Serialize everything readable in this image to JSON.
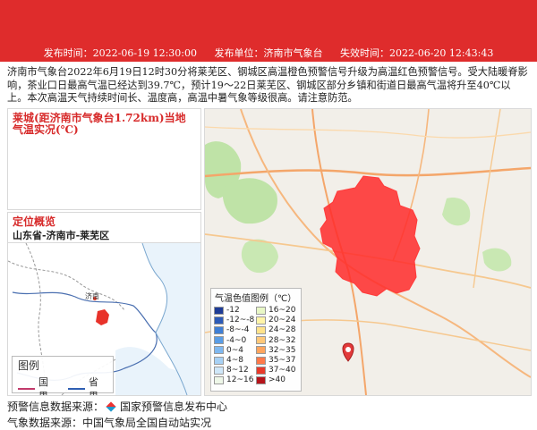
{
  "header": {
    "publish_time": "发布时间：2022-06-19 12:30:00",
    "publisher": "发布单位：济南市气象台",
    "expire_time": "失效时间：2022-06-20 12:43:43",
    "color": "#df2c2c"
  },
  "description": "济南市气象台2022年6月19日12时30分将莱芜区、钢城区高温橙色预警信号升级为高温红色预警信号。受大陆暖脊影响，茶业口日最高气温已经达到39.7℃，预计19～22日莱芜区、钢城区部分乡镇和街道日最高气温将升至40℃以上。本次高温天气持续时间长、温度高，高温中暑气象等级很高。请注意防范。",
  "temp_panel": {
    "title": "莱城(距济南市气象台1.72km)当地气温实况(℃)"
  },
  "location": {
    "title": "定位概览",
    "path": "山东省-济南市-莱芜区"
  },
  "minimap": {
    "city_label": "济南",
    "legend_title": "图例",
    "national_border": "国界",
    "provincial_border": "省界"
  },
  "mainmap": {
    "legend_title": "气温色值图例（℃）",
    "legend_items": [
      {
        "label": "-12",
        "color": "#1e3c96"
      },
      {
        "label": "16~20",
        "color": "#e8f7c6"
      },
      {
        "label": "-12~-8",
        "color": "#2d5bb8"
      },
      {
        "label": "20~24",
        "color": "#fff4a8"
      },
      {
        "label": "-8~-4",
        "color": "#3f7fd6"
      },
      {
        "label": "24~28",
        "color": "#ffe28a"
      },
      {
        "label": "-4~0",
        "color": "#5a9de6"
      },
      {
        "label": "28~32",
        "color": "#ffc879"
      },
      {
        "label": "0~4",
        "color": "#7fb8f0"
      },
      {
        "label": "32~35",
        "color": "#ffa55e"
      },
      {
        "label": "4~8",
        "color": "#a7d1f5"
      },
      {
        "label": "35~37",
        "color": "#ff7a4a"
      },
      {
        "label": "8~12",
        "color": "#cfe7f9"
      },
      {
        "label": "37~40",
        "color": "#e83a2a"
      },
      {
        "label": "12~16",
        "color": "#eef7e8"
      },
      {
        "label": ">40",
        "color": "#b5141a"
      }
    ]
  },
  "footer": {
    "source1": "预警信息数据来源：",
    "source1_org": "国家预警信息发布中心",
    "source2": "气象数据来源：中国气象局全国自动站实况"
  }
}
